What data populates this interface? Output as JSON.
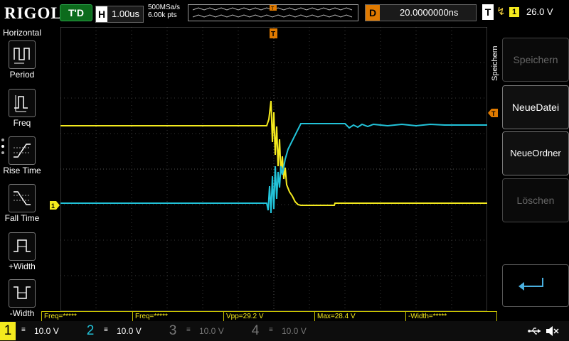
{
  "header": {
    "logo": "RIGOL",
    "trigger_status": "T'D",
    "horizontal_label": "H",
    "timebase": "1.00us",
    "sample_rate": "500MSa/s",
    "memory_depth": "6.00k pts",
    "delay_label": "D",
    "delay_value": "20.0000000ns",
    "trigger_label": "T",
    "trigger_source": "1",
    "trigger_level": "26.0 V"
  },
  "left_panel": {
    "title": "Horizontal",
    "items": [
      {
        "label": "Period",
        "icon": "period-icon"
      },
      {
        "label": "Freq",
        "icon": "freq-icon"
      },
      {
        "label": "Rise Time",
        "icon": "rise-time-icon"
      },
      {
        "label": "Fall Time",
        "icon": "fall-time-icon"
      },
      {
        "label": "+Width",
        "icon": "positive-width-icon"
      },
      {
        "label": "-Width",
        "icon": "negative-width-icon"
      }
    ]
  },
  "right_menu": {
    "title": "Speichern",
    "buttons": [
      {
        "label": "Speichern",
        "enabled": false
      },
      {
        "label": "NeueDatei",
        "enabled": true
      },
      {
        "label": "NeueOrdner",
        "enabled": true
      },
      {
        "label": "Löschen",
        "enabled": false
      }
    ],
    "back_icon": "return-arrow-icon"
  },
  "markers": {
    "trigger_position": "T",
    "trigger_level": "T",
    "ch1_ground": "1"
  },
  "measurements": [
    {
      "text": "Freq=*****"
    },
    {
      "text": "Freq=*****"
    },
    {
      "text": "Vpp=29.2 V"
    },
    {
      "text": "Max=28.4 V"
    },
    {
      "text": "-Width=*****"
    }
  ],
  "channels": [
    {
      "number": "1",
      "scale": "10.0 V",
      "color": "#f4ea1e",
      "active": true
    },
    {
      "number": "2",
      "scale": "10.0 V",
      "color": "#22c3d9",
      "active": true
    },
    {
      "number": "3",
      "scale": "10.0 V",
      "color": "#777777",
      "active": false
    },
    {
      "number": "4",
      "scale": "10.0 V",
      "color": "#777777",
      "active": false
    }
  ],
  "status_icons": [
    "usb-icon",
    "speaker-muted-icon"
  ]
}
